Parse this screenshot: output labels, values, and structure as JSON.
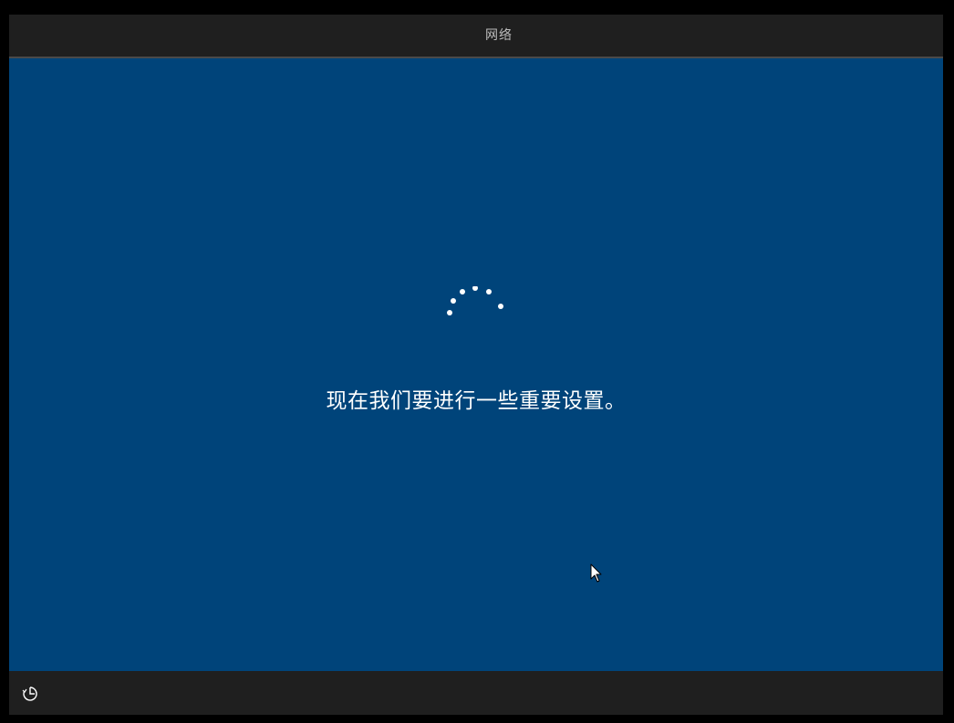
{
  "topbar": {
    "tabs": [
      {
        "label": "网络",
        "selected": true
      }
    ]
  },
  "main": {
    "status_text": "现在我们要进行一些重要设置。",
    "spinner_icon": "loading-dots-icon"
  },
  "bottombar": {
    "accessibility_icon": "ease-of-access-icon"
  },
  "colors": {
    "background": "#00447a",
    "bar": "#1f1f1f",
    "tab_text": "#bdbdbd",
    "accent": "#ffffff"
  }
}
